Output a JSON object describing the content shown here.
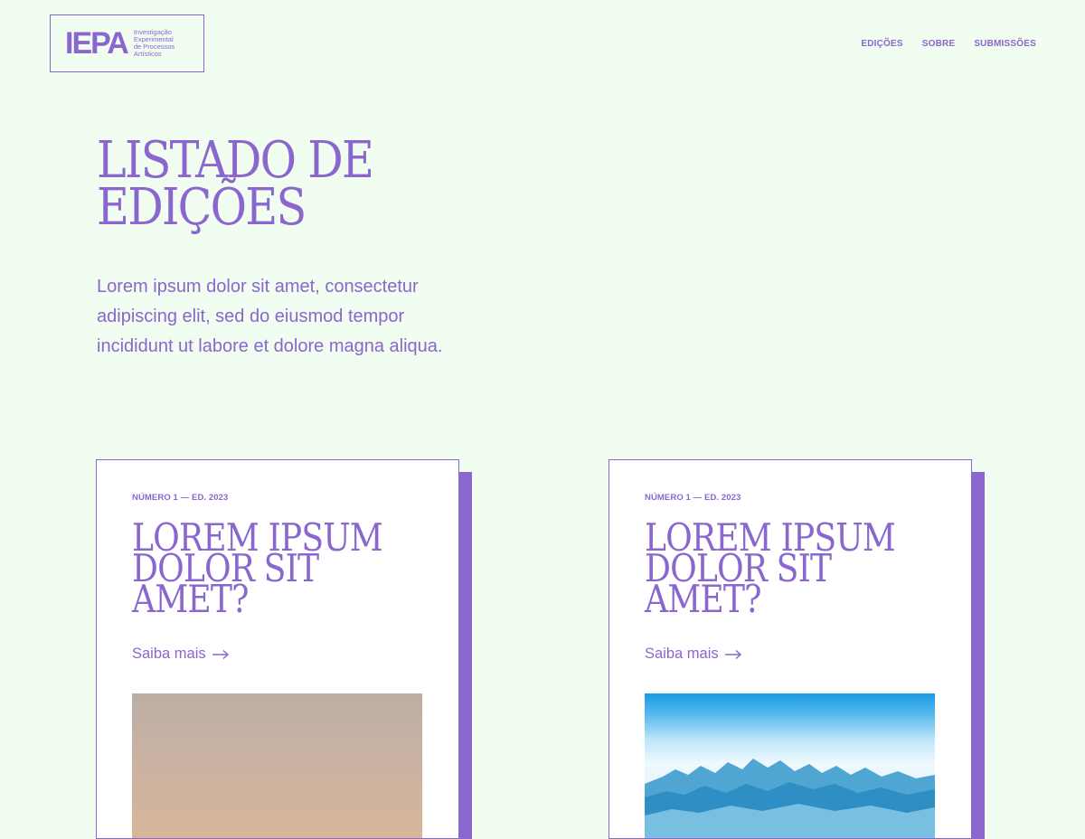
{
  "header": {
    "logo_mark": "IEPA",
    "logo_sub": [
      "Investigação",
      "Experimental",
      "de Processos",
      "Artísticos"
    ],
    "nav": [
      "EDIÇÕES",
      "SOBRE",
      "SUBMISSÕES"
    ]
  },
  "hero": {
    "title_line1": "LISTADO DE",
    "title_line2": "EDIÇÕES",
    "intro": "Lorem ipsum dolor sit amet, consectetur adipiscing elit, sed do eiusmod tempor incididunt ut labore et dolore magna aliqua."
  },
  "cards": [
    {
      "meta": "NÚMERO 1 — ED. 2023",
      "title_line1": "LOREM IPSUM",
      "title_line2": "DOLOR SIT",
      "title_line3": "AMET?",
      "link": "Saiba mais",
      "image": "warm-gradient-photo"
    },
    {
      "meta": "NÚMERO 1 — ED. 2023",
      "title_line1": "LOREM IPSUM",
      "title_line2": "DOLOR SIT",
      "title_line3": "AMET?",
      "link": "Saiba mais",
      "image": "mountains-above-clouds-photo"
    }
  ],
  "colors": {
    "background": "#f0fdf0",
    "accent": "#8a66cf",
    "card": "#ffffff"
  }
}
